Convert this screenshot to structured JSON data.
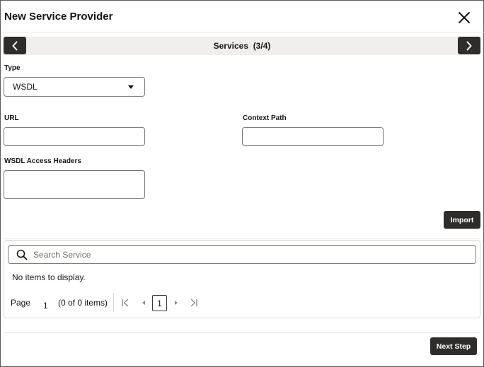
{
  "dialog": {
    "title": "New Service Provider",
    "close_icon": "close-icon"
  },
  "stepper": {
    "label": "Services",
    "progress": "(3/4)",
    "prev_icon": "chevron-left-icon",
    "next_icon": "chevron-right-icon"
  },
  "form": {
    "type": {
      "label": "Type",
      "value": "WSDL",
      "icon": "caret-down-icon"
    },
    "url": {
      "label": "URL",
      "value": ""
    },
    "context_path": {
      "label": "Context Path",
      "value": ""
    },
    "wsdl_access_headers": {
      "label": "WSDL Access Headers",
      "value": ""
    },
    "import_label": "Import"
  },
  "services": {
    "search_placeholder": "Search Service",
    "search_icon": "search-icon",
    "empty_message": "No items to display.",
    "pagination": {
      "page_label": "Page",
      "page_number": "1",
      "count_text": "(0 of 0 items)",
      "current_page": "1",
      "icons": [
        "first-page-icon",
        "previous-page-icon",
        "next-page-icon",
        "last-page-icon"
      ]
    }
  },
  "footer": {
    "next_step_label": "Next Step"
  },
  "colors": {
    "dark_button": "#2f2d2b",
    "step_bar": "#f1efed",
    "border": "#7a7773",
    "text": "#161513",
    "disabled": "#8a8785"
  }
}
